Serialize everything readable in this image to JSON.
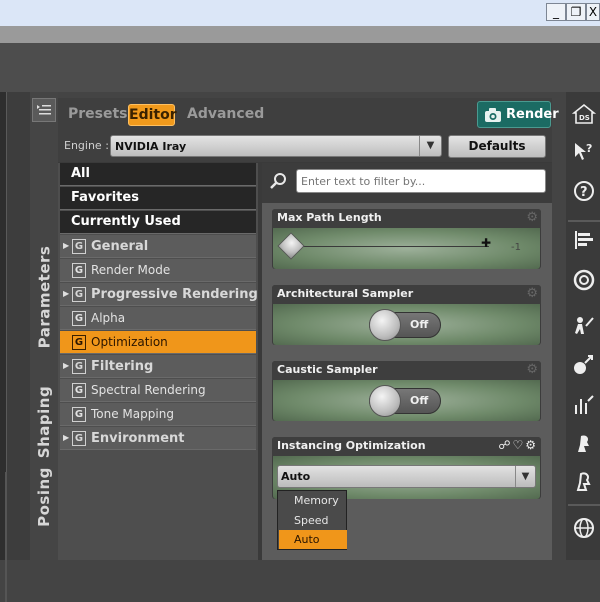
{
  "window": {
    "buttons": [
      "_",
      "❐",
      "X"
    ]
  },
  "side_tabs": [
    "Parameters",
    "Shaping",
    "Posing"
  ],
  "header": {
    "tabs": [
      "Presets",
      "Editor",
      "Advanced"
    ],
    "active_tab": "Editor",
    "render_label": "Render"
  },
  "engine": {
    "label": "Engine :",
    "value": "NVIDIA Iray",
    "defaults_label": "Defaults"
  },
  "categories": {
    "top": [
      "All",
      "Favorites",
      "Currently Used"
    ],
    "items": [
      {
        "label": "General",
        "group": true
      },
      {
        "label": "Render Mode",
        "group": false
      },
      {
        "label": "Progressive Rendering",
        "group": true
      },
      {
        "label": "Alpha",
        "group": false
      },
      {
        "label": "Optimization",
        "group": false,
        "selected": true
      },
      {
        "label": "Filtering",
        "group": true
      },
      {
        "label": "Spectral Rendering",
        "group": false
      },
      {
        "label": "Tone Mapping",
        "group": false
      },
      {
        "label": "Environment",
        "group": true
      }
    ],
    "badge": "G"
  },
  "filter": {
    "placeholder": "Enter text to filter by..."
  },
  "properties": {
    "max_path_length": {
      "title": "Max Path Length",
      "value": "-1"
    },
    "architectural_sampler": {
      "title": "Architectural Sampler",
      "state": "Off"
    },
    "caustic_sampler": {
      "title": "Caustic Sampler",
      "state": "Off"
    },
    "instancing_optimization": {
      "title": "Instancing Optimization",
      "value": "Auto",
      "options": [
        "Memory",
        "Speed",
        "Auto"
      ],
      "selected": "Auto"
    }
  },
  "colors": {
    "accent": "#f0961a",
    "render_button": "#1b6b63"
  }
}
